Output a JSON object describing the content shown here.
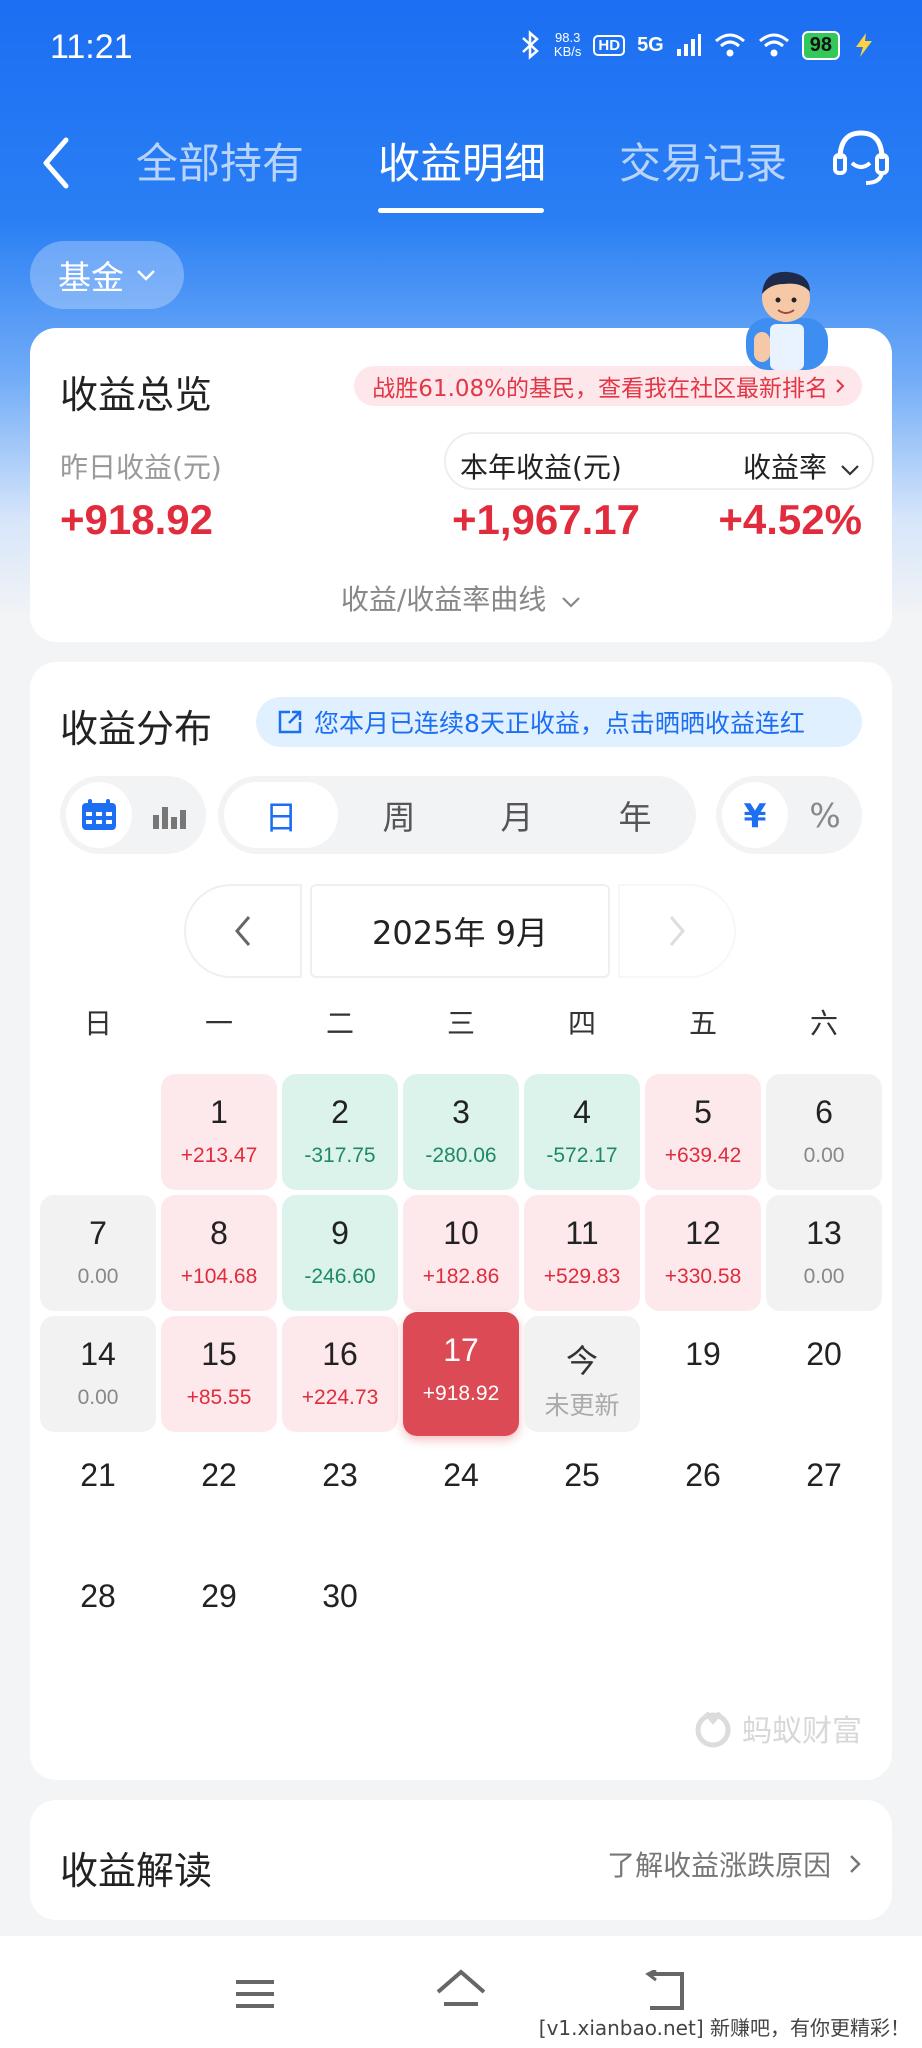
{
  "status_bar": {
    "time": "11:21",
    "net_speed_value": "98.3",
    "net_speed_unit": "KB/s",
    "hd": "HD",
    "network": "5G",
    "battery": "98"
  },
  "nav": {
    "tabs": [
      {
        "label": "全部持有"
      },
      {
        "label": "收益明细"
      },
      {
        "label": "交易记录"
      }
    ],
    "active_tab": 1
  },
  "filter": {
    "fund_label": "基金"
  },
  "overview": {
    "title": "收益总览",
    "rank_text": "战胜61.08%的基民，查看我在社区最新排名",
    "yesterday_label": "昨日收益(元)",
    "yesterday_value": "+918.92",
    "year_label": "本年收益(元)",
    "year_value": "+1,967.17",
    "rate_label": "收益率",
    "rate_value": "+4.52%",
    "curve_label": "收益/收益率曲线"
  },
  "distribution": {
    "title": "收益分布",
    "streak_text": "您本月已连续8天正收益，点击晒晒收益连红",
    "periods": [
      "日",
      "周",
      "月",
      "年"
    ],
    "active_period": 0,
    "units": [
      "¥",
      "%"
    ],
    "month_label": "2025年 9月",
    "weekdays": [
      "日",
      "一",
      "二",
      "三",
      "四",
      "五",
      "六"
    ],
    "days": [
      {
        "day": "1",
        "value": "+213.47",
        "type": "pos"
      },
      {
        "day": "2",
        "value": "-317.75",
        "type": "neg"
      },
      {
        "day": "3",
        "value": "-280.06",
        "type": "neg"
      },
      {
        "day": "4",
        "value": "-572.17",
        "type": "neg"
      },
      {
        "day": "5",
        "value": "+639.42",
        "type": "pos"
      },
      {
        "day": "6",
        "value": "0.00",
        "type": "zero"
      },
      {
        "day": "7",
        "value": "0.00",
        "type": "zero"
      },
      {
        "day": "8",
        "value": "+104.68",
        "type": "pos"
      },
      {
        "day": "9",
        "value": "-246.60",
        "type": "neg"
      },
      {
        "day": "10",
        "value": "+182.86",
        "type": "pos"
      },
      {
        "day": "11",
        "value": "+529.83",
        "type": "pos"
      },
      {
        "day": "12",
        "value": "+330.58",
        "type": "pos"
      },
      {
        "day": "13",
        "value": "0.00",
        "type": "zero"
      },
      {
        "day": "14",
        "value": "0.00",
        "type": "zero"
      },
      {
        "day": "15",
        "value": "+85.55",
        "type": "pos"
      },
      {
        "day": "16",
        "value": "+224.73",
        "type": "pos"
      },
      {
        "day": "17",
        "value": "+918.92",
        "type": "sel"
      },
      {
        "day": "今",
        "value": "未更新",
        "type": "today"
      },
      {
        "day": "19",
        "value": "",
        "type": "plain"
      },
      {
        "day": "20",
        "value": "",
        "type": "plain"
      },
      {
        "day": "21",
        "value": "",
        "type": "plain"
      },
      {
        "day": "22",
        "value": "",
        "type": "plain"
      },
      {
        "day": "23",
        "value": "",
        "type": "plain"
      },
      {
        "day": "24",
        "value": "",
        "type": "plain"
      },
      {
        "day": "25",
        "value": "",
        "type": "plain"
      },
      {
        "day": "26",
        "value": "",
        "type": "plain"
      },
      {
        "day": "27",
        "value": "",
        "type": "plain"
      },
      {
        "day": "28",
        "value": "",
        "type": "plain"
      },
      {
        "day": "29",
        "value": "",
        "type": "plain"
      },
      {
        "day": "30",
        "value": "",
        "type": "plain"
      }
    ],
    "logo_text": "蚂蚁财富"
  },
  "interpretation": {
    "title": "收益解读",
    "link": "了解收益涨跌原因"
  },
  "watermark": "[v1.xianbao.net] 新赚吧，有你更精彩！"
}
